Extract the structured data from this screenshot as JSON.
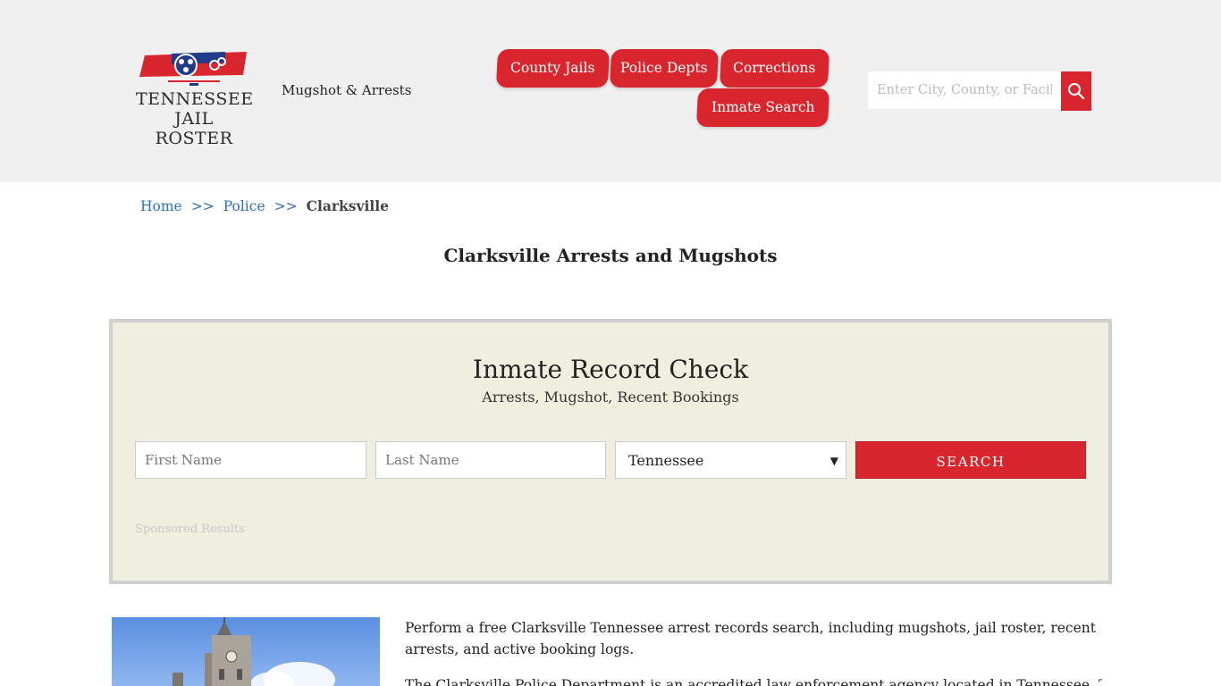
{
  "header": {
    "logo": {
      "line1": "TENNESSEE",
      "line2": "JAIL ROSTER"
    },
    "tagline": "Mugshot & Arrests",
    "nav": [
      {
        "label": "County Jails"
      },
      {
        "label": "Police Depts"
      },
      {
        "label": "Corrections"
      },
      {
        "label": "Inmate Search"
      }
    ],
    "search": {
      "placeholder": "Enter City, County, or Facility"
    }
  },
  "breadcrumb": {
    "home": "Home",
    "separator": ">>",
    "police": "Police",
    "current": "Clarksville"
  },
  "page_title": "Clarksville Arrests and Mugshots",
  "record_check": {
    "title": "Inmate Record Check",
    "subtitle": "Arrests, Mugshot, Recent Bookings",
    "first_name_placeholder": "First Name",
    "last_name_placeholder": "Last Name",
    "state_selected": "Tennessee",
    "submit_label": "SEARCH",
    "sponsored_label": "Sponsored Results"
  },
  "content": {
    "para1": "Perform a free Clarksville Tennessee arrest records search, including mugshots, jail roster, recent arrests, and active booking logs.",
    "para2": "The Clarksville Police Department is an accredited law enforcement agency located in Tennessee. The"
  },
  "colors": {
    "accent": "#d9262e",
    "header_bg": "#f0f0f0",
    "panel_bg": "#f0eedf",
    "link": "#2e6fc0"
  }
}
